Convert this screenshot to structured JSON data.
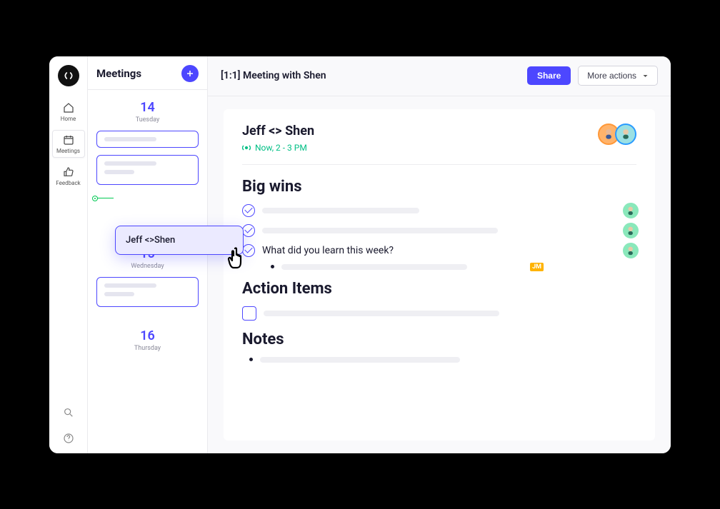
{
  "rail": {
    "home": "Home",
    "meetings": "Meetings",
    "feedback": "Feedback"
  },
  "meetings_panel": {
    "title": "Meetings",
    "dates": [
      {
        "num": "14",
        "day": "Tuesday"
      },
      {
        "num": "15",
        "day": "Wednesday"
      },
      {
        "num": "16",
        "day": "Thursday"
      }
    ],
    "selected_card": "Jeff <>Shen"
  },
  "topbar": {
    "title": "[1:1] Meeting with Shen",
    "share": "Share",
    "more": "More actions"
  },
  "doc": {
    "title": "Jeff <> Shen",
    "time": "Now, 2 - 3 PM",
    "sections": {
      "wins": "Big wins",
      "q1": "What did you learn this week?",
      "badge": "JM",
      "actions": "Action Items",
      "notes": "Notes"
    }
  }
}
